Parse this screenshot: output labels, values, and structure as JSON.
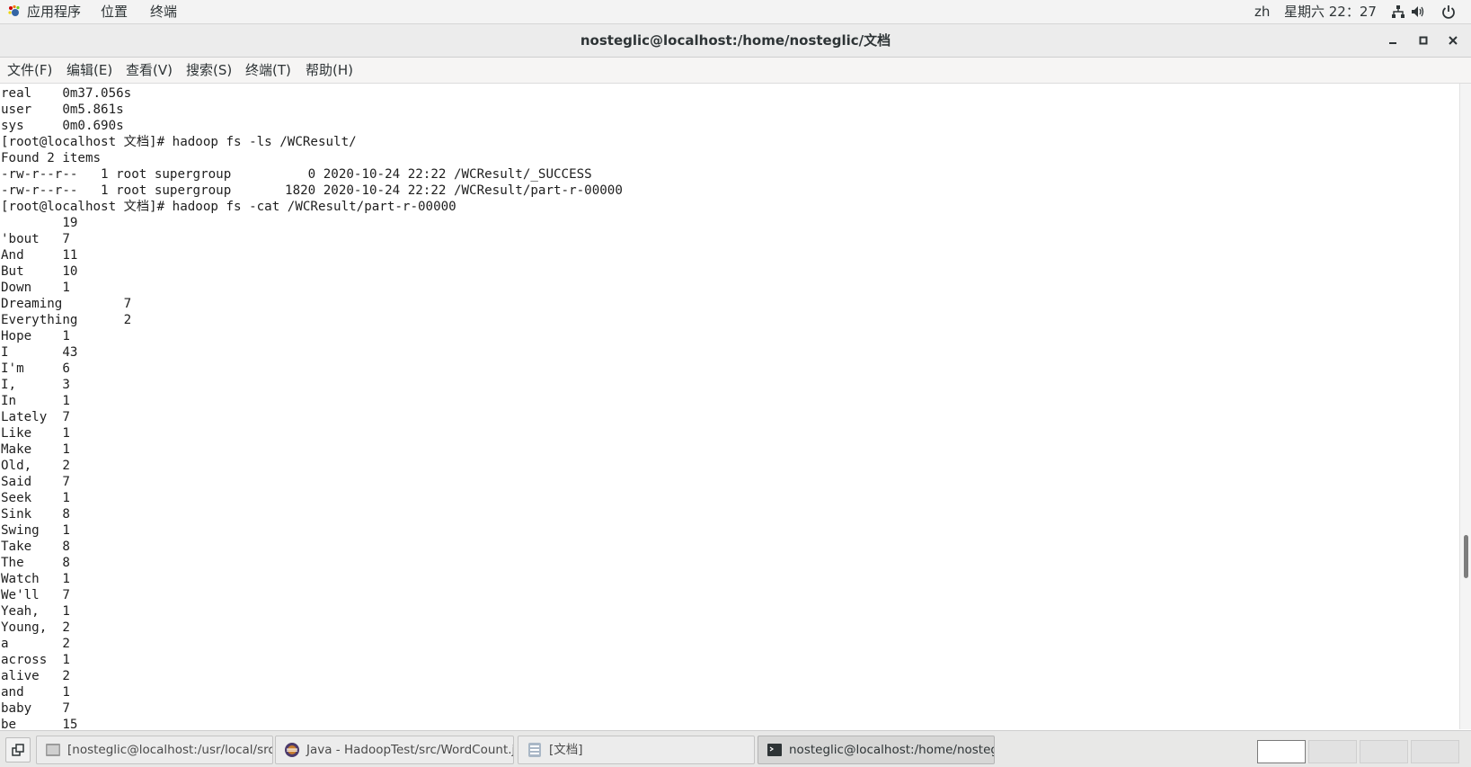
{
  "topbar": {
    "apps_menu": "应用程序",
    "places_menu": "位置",
    "terminal_menu": "终端",
    "input_method": "zh",
    "clock": "星期六 22：27"
  },
  "window": {
    "title": "nosteglic@localhost:/home/nosteglic/文档"
  },
  "menubar": {
    "file": "文件(F)",
    "edit": "编辑(E)",
    "view": "查看(V)",
    "search": "搜索(S)",
    "terminal": "终端(T)",
    "help": "帮助(H)"
  },
  "terminal": {
    "lines": [
      "real    0m37.056s",
      "user    0m5.861s",
      "sys     0m0.690s",
      "[root@localhost 文档]# hadoop fs -ls /WCResult/",
      "Found 2 items",
      "-rw-r--r--   1 root supergroup          0 2020-10-24 22:22 /WCResult/_SUCCESS",
      "-rw-r--r--   1 root supergroup       1820 2020-10-24 22:22 /WCResult/part-r-00000",
      "[root@localhost 文档]# hadoop fs -cat /WCResult/part-r-00000",
      "        19",
      "'bout   7",
      "And     11",
      "But     10",
      "Down    1",
      "Dreaming        7",
      "Everything      2",
      "Hope    1",
      "I       43",
      "I'm     6",
      "I,      3",
      "In      1",
      "Lately  7",
      "Like    1",
      "Make    1",
      "Old,    2",
      "Said    7",
      "Seek    1",
      "Sink    8",
      "Swing   1",
      "Take    8",
      "The     8",
      "Watch   1",
      "We'll   7",
      "Yeah,   1",
      "Young,  2",
      "a       2",
      "across  1",
      "alive   2",
      "and     1",
      "baby    7",
      "be      15"
    ]
  },
  "taskbar": {
    "tasks": [
      {
        "label": "[nosteglic@localhost:/usr/local/src/···",
        "icon": "terminal-icon",
        "active": false
      },
      {
        "label": "Java - HadoopTest/src/WordCount.j···",
        "icon": "eclipse-icon",
        "active": false
      },
      {
        "label": "[文档]",
        "icon": "file-manager-icon",
        "active": false
      },
      {
        "label": "nosteglic@localhost:/home/nostegli···",
        "icon": "terminal-icon",
        "active": true
      }
    ],
    "workspaces": 4,
    "active_workspace": 1
  }
}
